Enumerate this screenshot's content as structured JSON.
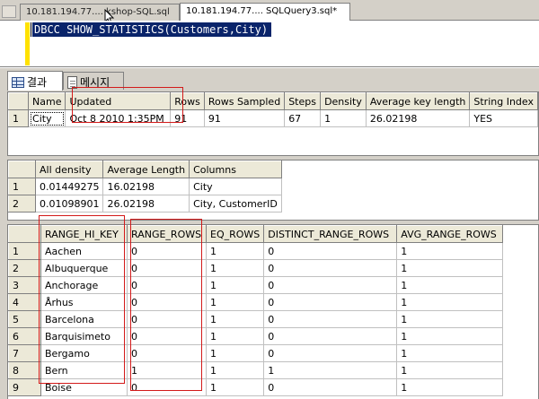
{
  "doc_tabs": [
    {
      "label": "10.181.194.77.... kshop-SQL.sql",
      "active": false
    },
    {
      "label": "10.181.194.77.... SQLQuery3.sql*",
      "active": true
    }
  ],
  "editor": {
    "query": "DBCC SHOW_STATISTICS(Customers,City)"
  },
  "result_tabs": [
    {
      "label": "결과",
      "icon": "grid-icon",
      "active": true
    },
    {
      "label": "메시지",
      "icon": "message-icon",
      "active": false
    }
  ],
  "header_table": {
    "columns": [
      "Name",
      "Updated",
      "Rows",
      "Rows Sampled",
      "Steps",
      "Density",
      "Average key length",
      "String Index"
    ],
    "rows": [
      [
        "1",
        "City",
        "Oct  8 2010  1:35PM",
        "91",
        "91",
        "67",
        "1",
        "26.02198",
        "YES"
      ]
    ]
  },
  "density_table": {
    "columns": [
      "All density",
      "Average Length",
      "Columns"
    ],
    "rows": [
      [
        "1",
        "0.01449275",
        "16.02198",
        "City"
      ],
      [
        "2",
        "0.01098901",
        "26.02198",
        "City, CustomerID"
      ]
    ]
  },
  "histogram_table": {
    "columns": [
      "RANGE_HI_KEY",
      "RANGE_ROWS",
      "EQ_ROWS",
      "DISTINCT_RANGE_ROWS",
      "AVG_RANGE_ROWS"
    ],
    "rows": [
      [
        "1",
        "Aachen",
        "0",
        "1",
        "0",
        "1"
      ],
      [
        "2",
        "Albuquerque",
        "0",
        "1",
        "0",
        "1"
      ],
      [
        "3",
        "Anchorage",
        "0",
        "1",
        "0",
        "1"
      ],
      [
        "4",
        "Århus",
        "0",
        "1",
        "0",
        "1"
      ],
      [
        "5",
        "Barcelona",
        "0",
        "1",
        "0",
        "1"
      ],
      [
        "6",
        "Barquisimeto",
        "0",
        "1",
        "0",
        "1"
      ],
      [
        "7",
        "Bergamo",
        "0",
        "1",
        "0",
        "1"
      ],
      [
        "8",
        "Bern",
        "1",
        "1",
        "1",
        "1"
      ],
      [
        "9",
        "Boise",
        "0",
        "1",
        "0",
        "1"
      ]
    ]
  },
  "colors": {
    "selection": "#0a246a",
    "annotation": "#d31a1a",
    "chrome": "#d4d0c8"
  }
}
